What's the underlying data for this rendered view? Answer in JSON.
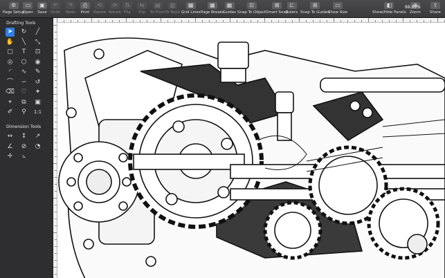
{
  "toolbar": {
    "items": [
      {
        "label": "Page Setup",
        "icon": "gear-icon",
        "glyph": "⚙"
      },
      {
        "label": "Open",
        "icon": "folder-icon",
        "glyph": "▭"
      },
      {
        "label": "Save",
        "icon": "save-icon",
        "glyph": "▣"
      },
      {
        "label": "Undo",
        "icon": "undo-icon",
        "glyph": "↶"
      },
      {
        "label": "Redo",
        "icon": "redo-icon",
        "glyph": "↷"
      },
      {
        "label": "Print",
        "icon": "print-icon",
        "glyph": "⎙"
      },
      {
        "label": "Rotate",
        "icon": "rotate-icon",
        "glyph": "⟲"
      },
      {
        "label": "Rotate",
        "icon": "rotate-icon",
        "glyph": "⟳"
      },
      {
        "label": "Flip",
        "icon": "flip-icon",
        "glyph": "⇅"
      },
      {
        "label": "Flip",
        "icon": "flip-icon",
        "glyph": "⇆"
      },
      {
        "label": "To Front",
        "icon": "bring-front-icon",
        "glyph": "▤"
      },
      {
        "label": "To Back",
        "icon": "send-back-icon",
        "glyph": "▥"
      },
      {
        "label": "Grid Lines",
        "icon": "grid-icon",
        "glyph": "▦"
      },
      {
        "label": "Page Breaks",
        "icon": "page-breaks-icon",
        "glyph": "▦"
      },
      {
        "label": "Guides",
        "icon": "guides-icon",
        "glyph": "▦"
      },
      {
        "label": "Snap To Object",
        "icon": "snap-object-icon",
        "glyph": "⊡"
      },
      {
        "label": "Smart Snap",
        "icon": "smart-snap-icon",
        "glyph": "⊠"
      },
      {
        "label": "Rulers",
        "icon": "rulers-icon",
        "glyph": "⊏"
      },
      {
        "label": "Snap To Guides",
        "icon": "snap-guides-icon",
        "glyph": "⊞"
      },
      {
        "label": "Show Size",
        "icon": "show-size-icon",
        "glyph": "▭"
      },
      {
        "label": "Show/Hide Panels",
        "icon": "panels-icon",
        "glyph": "◧"
      },
      {
        "label": "Zoom",
        "icon": "zoom-icon",
        "glyph": "⊕"
      },
      {
        "label": "Share",
        "icon": "share-icon",
        "glyph": "⇪"
      }
    ],
    "zoom_value": "88.89%"
  },
  "drafting_tools": {
    "title": "Drafting Tools",
    "tools": [
      {
        "name": "pointer-tool-icon",
        "glyph": "➤"
      },
      {
        "name": "rotate-tool-icon",
        "glyph": "↻"
      },
      {
        "name": "line-tool-icon",
        "glyph": "╱"
      },
      {
        "name": "hand-tool-icon",
        "glyph": "✋"
      },
      {
        "name": "line-tool-2-icon",
        "glyph": "╲"
      },
      {
        "name": "dimension-line-icon",
        "glyph": "⤡"
      },
      {
        "name": "rectangle-tool-icon",
        "glyph": "▢"
      },
      {
        "name": "text-tool-icon",
        "glyph": "T"
      },
      {
        "name": "textbox-tool-icon",
        "glyph": "⊡"
      },
      {
        "name": "circle-tool-icon",
        "glyph": "◎"
      },
      {
        "name": "polygon-tool-icon",
        "glyph": "⬡"
      },
      {
        "name": "shape-tool-icon",
        "glyph": "◉"
      },
      {
        "name": "arc-tool-icon",
        "glyph": "◜"
      },
      {
        "name": "curve-tool-icon",
        "glyph": "∿"
      },
      {
        "name": "pen-tool-icon",
        "glyph": "✎"
      },
      {
        "name": "freehand-tool-icon",
        "glyph": "⌒"
      },
      {
        "name": "bezier-tool-icon",
        "glyph": "∽"
      },
      {
        "name": "spiral-tool-icon",
        "glyph": "↺"
      },
      {
        "name": "eraser-tool-icon",
        "glyph": "⌫"
      },
      {
        "name": "heart-shape-icon",
        "glyph": "♡"
      },
      {
        "name": "star-shape-icon",
        "glyph": "✦"
      },
      {
        "name": "crosshair-tool-icon",
        "glyph": "⌖"
      },
      {
        "name": "stamp-tool-icon",
        "glyph": "⧉"
      },
      {
        "name": "image-tool-icon",
        "glyph": "▣"
      },
      {
        "name": "eyedropper-tool-icon",
        "glyph": "✐"
      },
      {
        "name": "magnify-tool-icon",
        "glyph": "⚲"
      },
      {
        "name": "one-to-one-label",
        "glyph": "1:1"
      }
    ]
  },
  "dimension_tools": {
    "title": "Dimension Tools",
    "tools": [
      {
        "name": "horizontal-dimension-icon",
        "glyph": "↔"
      },
      {
        "name": "vertical-dimension-icon",
        "glyph": "↕"
      },
      {
        "name": "aligned-dimension-icon",
        "glyph": "↗"
      },
      {
        "name": "angle-dimension-icon",
        "glyph": "∠"
      },
      {
        "name": "diameter-dimension-icon",
        "glyph": "⊘"
      },
      {
        "name": "radius-dimension-icon",
        "glyph": "◔"
      },
      {
        "name": "center-mark-icon",
        "glyph": "✛"
      },
      {
        "name": "angular-dimension-icon",
        "glyph": "⦣"
      }
    ]
  }
}
